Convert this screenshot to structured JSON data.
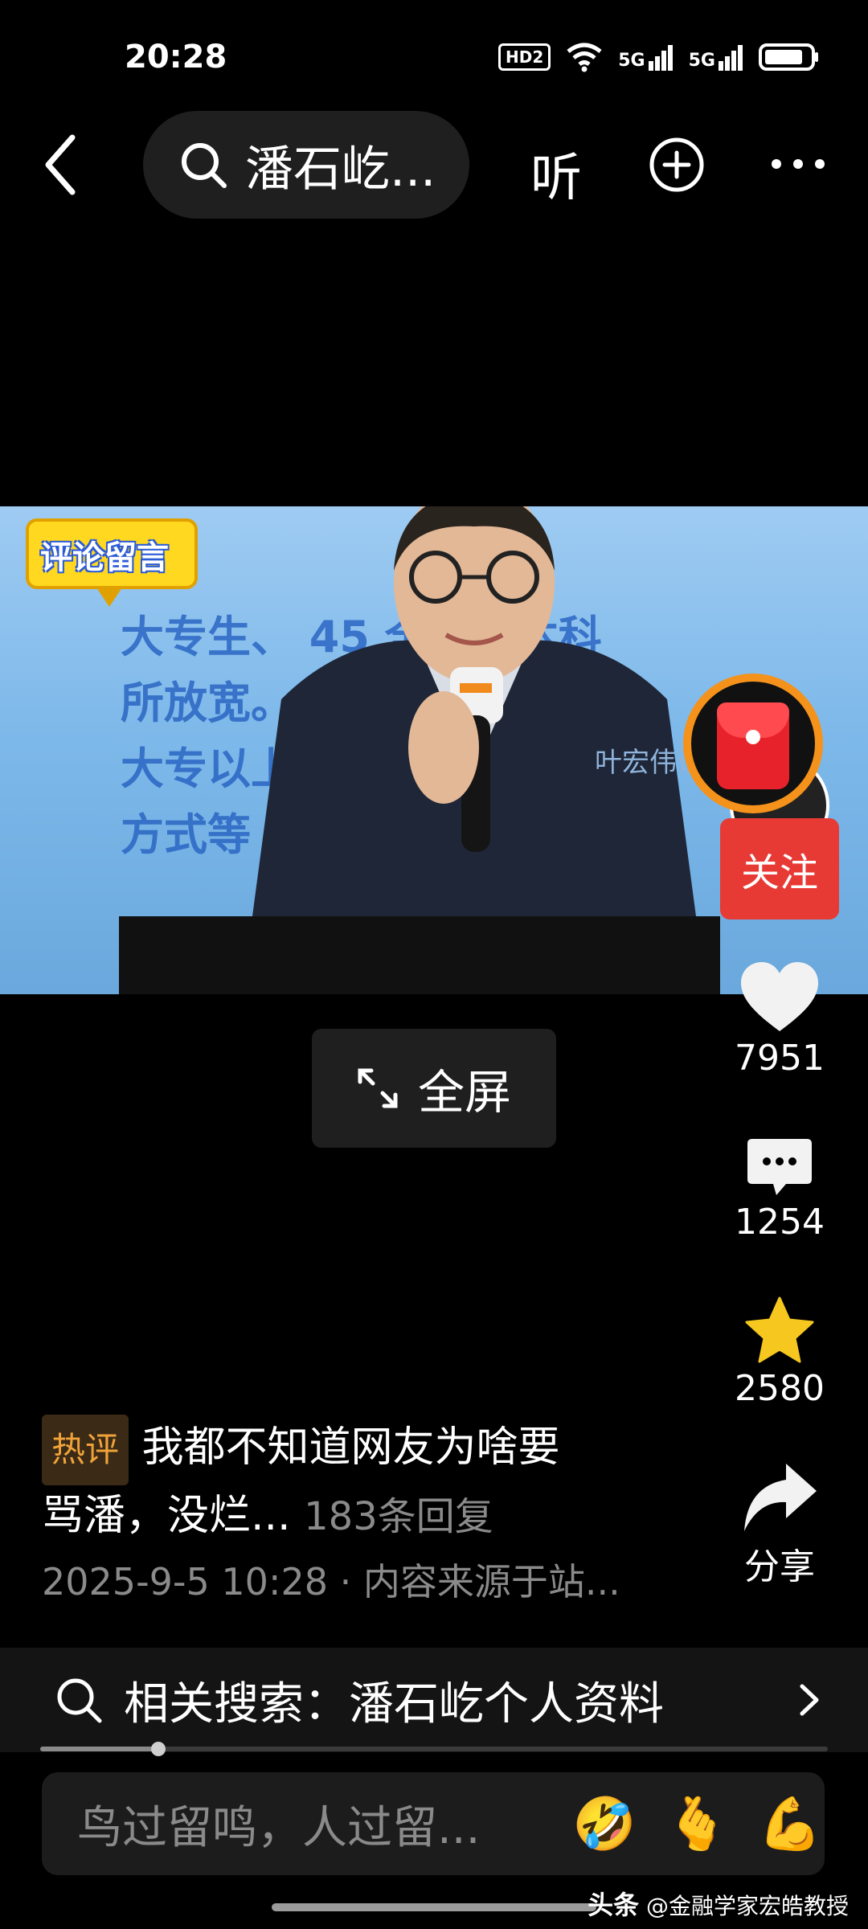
{
  "status_bar": {
    "time": "20:28",
    "hd_label": "HD2",
    "net1": "5G",
    "net2": "5G",
    "icons": [
      "hd-voice-icon",
      "wifi-icon",
      "signal-5g-icon",
      "signal-5g-icon",
      "battery-icon"
    ]
  },
  "top_nav": {
    "search_text": "潘石屹...",
    "listen_label": "听",
    "icons": [
      "back-icon",
      "search-icon",
      "add-circle-icon",
      "more-icon"
    ]
  },
  "video": {
    "comment_tag": "评论留言",
    "overlay_lines": [
      "大专生、 45 全日制本科",
      "所放宽。",
      "大专以上",
      "方式等"
    ],
    "speaker_watermark": "叶宏伟讲堂"
  },
  "fullscreen": {
    "label": "全屏"
  },
  "rail": {
    "follow_label": "关注",
    "likes": "7951",
    "comments": "1254",
    "favorites": "2580",
    "share_label": "分享"
  },
  "caption": {
    "hot_badge": "热评",
    "line1": "我都不知道网友为啥要",
    "line2": "骂潘，没烂...",
    "reply_count": "183条回复",
    "meta": "2025-9-5 10:28 · 内容来源于站..."
  },
  "related_search": {
    "label": "相关搜索：潘石屹个人资料",
    "progress_fraction": 0.15
  },
  "comment_input": {
    "placeholder": "鸟过留鸣，人过留...",
    "emojis": [
      "🤣",
      "🫰",
      "💪"
    ]
  },
  "source_mark": {
    "brand": "头条",
    "handle": "@金融学家宏皓教授"
  }
}
